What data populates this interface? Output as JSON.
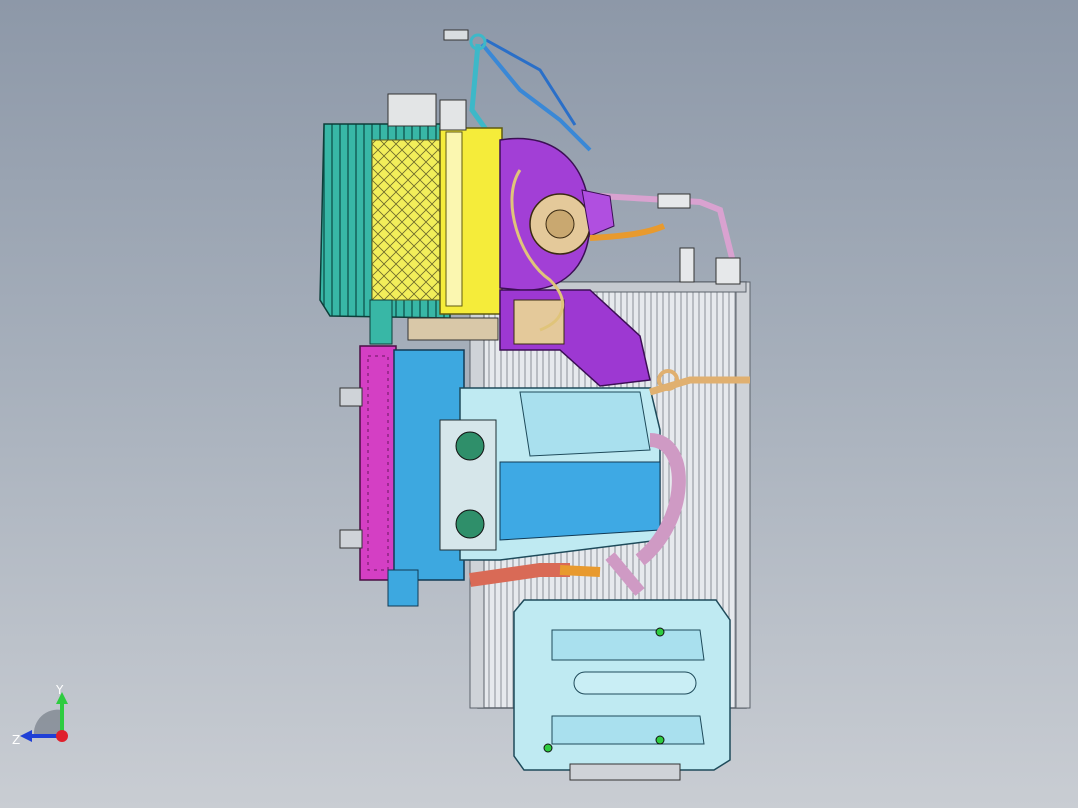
{
  "viewport": {
    "background_top": "#8d98a8",
    "background_bottom": "#c9cdd3"
  },
  "model": {
    "parts": [
      "cyan-filter-housing",
      "yellow-blower-frame",
      "purple-blower-scroll",
      "magenta-duct",
      "blue-hvac-case",
      "radiator-core",
      "lower-reservoir-tank",
      "hoses"
    ],
    "colors": {
      "cyan": "#2fb8a8",
      "yellow": "#f5ec3a",
      "purple": "#a23fd6",
      "magenta": "#d43fc4",
      "blue": "#3da8e0",
      "light_cyan": "#bfeaf2",
      "radiator": "#d9dde2",
      "hose_orange": "#e89a2e",
      "hose_pink": "#cf9ac4",
      "hose_red": "#d96a56"
    }
  },
  "triad": {
    "y_label": "Y",
    "z_label": "Z",
    "y_color": "#2ecc40",
    "z_color": "#1f3fd6",
    "x_color": "#e0202c"
  }
}
